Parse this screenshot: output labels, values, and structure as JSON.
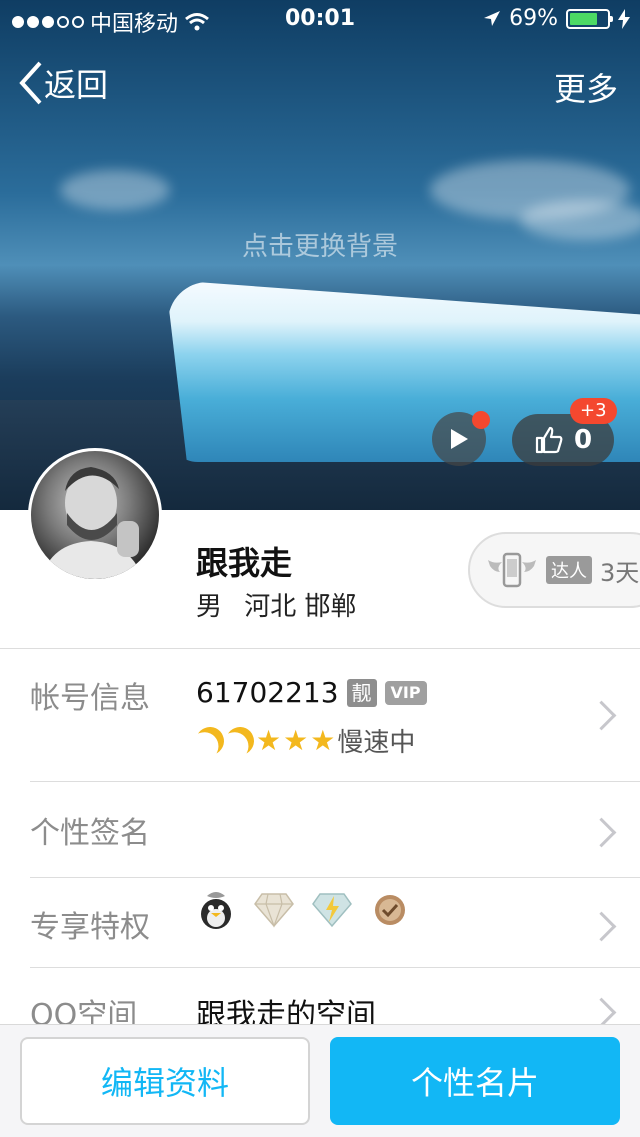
{
  "status_bar": {
    "carrier": "中国移动",
    "time": "00:01",
    "battery": "69%",
    "battery_level": 0.69
  },
  "nav": {
    "back_label": "返回",
    "more_label": "更多"
  },
  "cover": {
    "change_bg_label": "点击更换背景",
    "like_count": "0",
    "like_badge": "+3"
  },
  "profile": {
    "name": "跟我走",
    "gender": "男",
    "location": "河北 邯郸",
    "daren_tag": "达人",
    "daren_days": "3天"
  },
  "rows": {
    "account": {
      "label": "帐号信息",
      "qq_number": "61702213",
      "liang_tag": "靓",
      "vip_tag": "VIP",
      "level_status": "慢速中"
    },
    "signature": {
      "label": "个性签名"
    },
    "privileges": {
      "label": "专享特权",
      "icons": [
        "qq-penguin-icon",
        "diamond-icon",
        "lightning-diamond-icon",
        "check-badge-icon"
      ]
    },
    "qzone": {
      "label": "QQ空间",
      "value": "跟我走的空间"
    }
  },
  "bottom": {
    "edit_label": "编辑资料",
    "card_label": "个性名片"
  },
  "colors": {
    "accent": "#12b7f5",
    "badge_red": "#f4482f",
    "battery_green": "#4cd964",
    "star_gold": "#f3b81e"
  }
}
